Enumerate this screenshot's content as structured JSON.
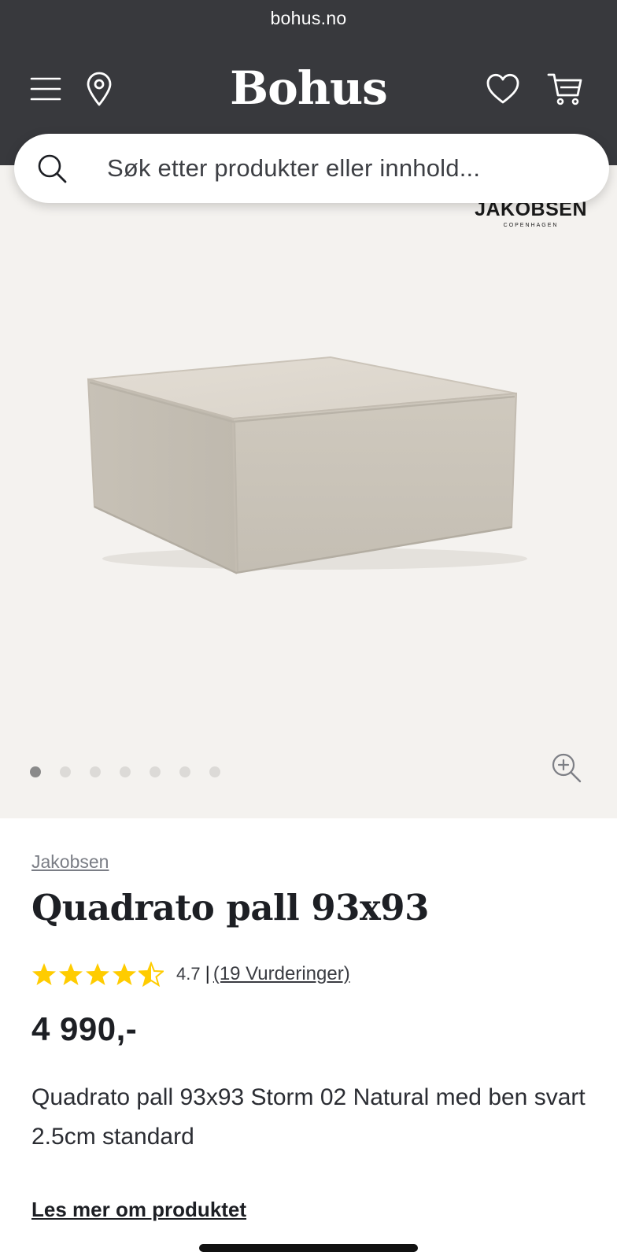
{
  "browser": {
    "url": "bohus.no"
  },
  "header": {
    "logo": "Bohus",
    "icons": {
      "menu": "hamburger-menu-icon",
      "location": "location-pin-icon",
      "wishlist": "heart-icon",
      "cart": "shopping-cart-icon"
    }
  },
  "search": {
    "placeholder": "Søk etter produkter eller innhold...",
    "icon": "search-icon"
  },
  "gallery": {
    "brand_logo": {
      "name": "JAKOBSEN",
      "sub": "COPENHAGEN"
    },
    "image_count": 7,
    "active_index": 0,
    "zoom_icon": "zoom-in-icon"
  },
  "product": {
    "brand": "Jakobsen",
    "title": "Quadrato pall 93x93",
    "rating": {
      "value": "4.7",
      "stars": 4.5,
      "separator": "|",
      "reviews": "(19 Vurderinger)"
    },
    "price": "4 990,-",
    "description": "Quadrato pall 93x93 Storm 02 Natural med ben svart 2.5cm standard",
    "read_more": "Les mer om produktet"
  },
  "colors": {
    "header_bg": "#38393d",
    "gallery_bg": "#f4f2ef",
    "star": "#ffcc00",
    "text": "#1d1f24"
  }
}
